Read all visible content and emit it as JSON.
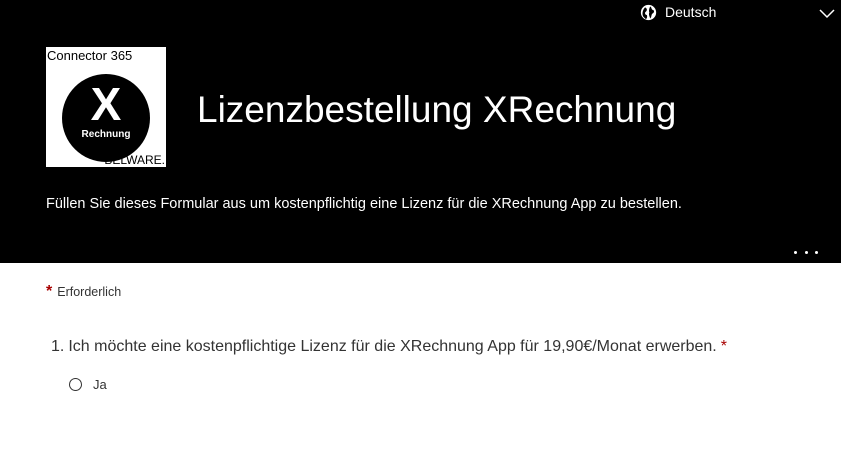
{
  "header": {
    "language": {
      "label": "Deutsch",
      "icon": "globe-icon",
      "chevron_icon": "chevron-down-icon"
    },
    "logo": {
      "top_text": "Connector 365",
      "mark_text": "X",
      "sub_text": "Rechnung",
      "bottom_text": "BELWARE."
    },
    "title": "Lizenzbestellung XRechnung",
    "description": "Füllen Sie dieses Formular aus um kostenpflichtig eine Lizenz für die XRechnung App zu bestellen.",
    "more_icon": "more-options-icon",
    "background_color": "#000000"
  },
  "form": {
    "required_marker": "*",
    "required_note": "Erforderlich",
    "questions": [
      {
        "number": "1.",
        "text": "Ich möchte eine kostenpflichtige Lizenz für die XRechnung App für 19,90€/Monat erwerben.",
        "required_marker": "*",
        "options": [
          {
            "label": "Ja",
            "selected": false
          }
        ]
      }
    ]
  },
  "colors": {
    "required": "#a80000",
    "text": "#333333"
  }
}
